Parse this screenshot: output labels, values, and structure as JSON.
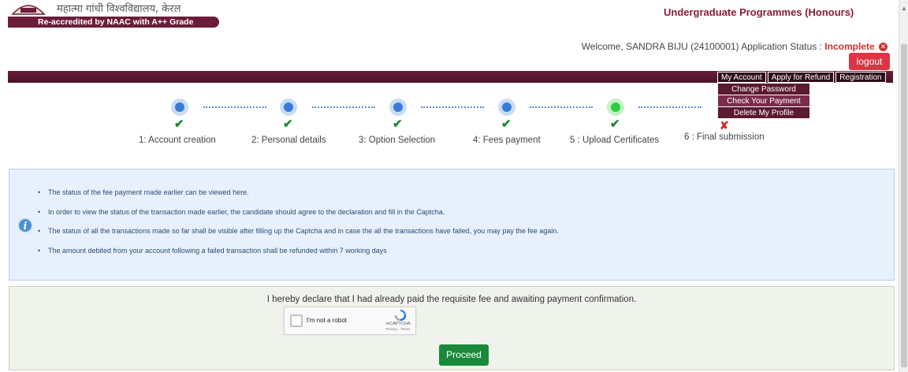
{
  "header": {
    "hindi_name": "महात्मा गांधी विश्वविद्यालय, केरल",
    "accreditation": "Re-accredited by NAAC with A++ Grade",
    "programme": "Undergraduate Programmes (Honours)"
  },
  "account": {
    "welcome": "Welcome, SANDRA BIJU (24100001) Application Status :",
    "status": "Incomplete",
    "logout_label": "logout"
  },
  "nav": {
    "items": [
      "My Account",
      "Apply for Refund",
      "Registration"
    ],
    "dropdown": [
      "Change Password",
      "Check Your Payment",
      "Delete My Profile"
    ]
  },
  "steps": [
    {
      "label": "1: Account creation",
      "status": "done"
    },
    {
      "label": "2: Personal details",
      "status": "done"
    },
    {
      "label": "3: Option Selection",
      "status": "done"
    },
    {
      "label": "4: Fees payment",
      "status": "done"
    },
    {
      "label": "5 : Upload Certificates",
      "status": "done"
    },
    {
      "label": "6 : Final submission",
      "status": "pending"
    }
  ],
  "info": {
    "items": [
      "The status of the fee payment made earlier can be viewed here.",
      "In order to view the status of the transaction made earlier, the candidate should agree to the declaration and fill in the Captcha.",
      "The status of all the transactions made so far shall be visible after filling up the Captcha and in case the all the transactions have failed, you may pay the fee again.",
      "The amount debited from your account following a failed transaction shall be refunded within 7 working days"
    ]
  },
  "declaration": {
    "text": "I hereby declare that I had already paid the requisite fee and awaiting payment confirmation.",
    "captcha_label": "I'm not a robot",
    "captcha_brand": "reCAPTCHA",
    "captcha_terms": "Privacy - Terms",
    "proceed_label": "Proceed"
  },
  "colors": {
    "brand_maroon": "#6b1d3a",
    "step_blue": "#3a7bd5",
    "step_green": "#2ecc40",
    "success_green": "#1a8a3a",
    "danger_red": "#d32f2f"
  }
}
